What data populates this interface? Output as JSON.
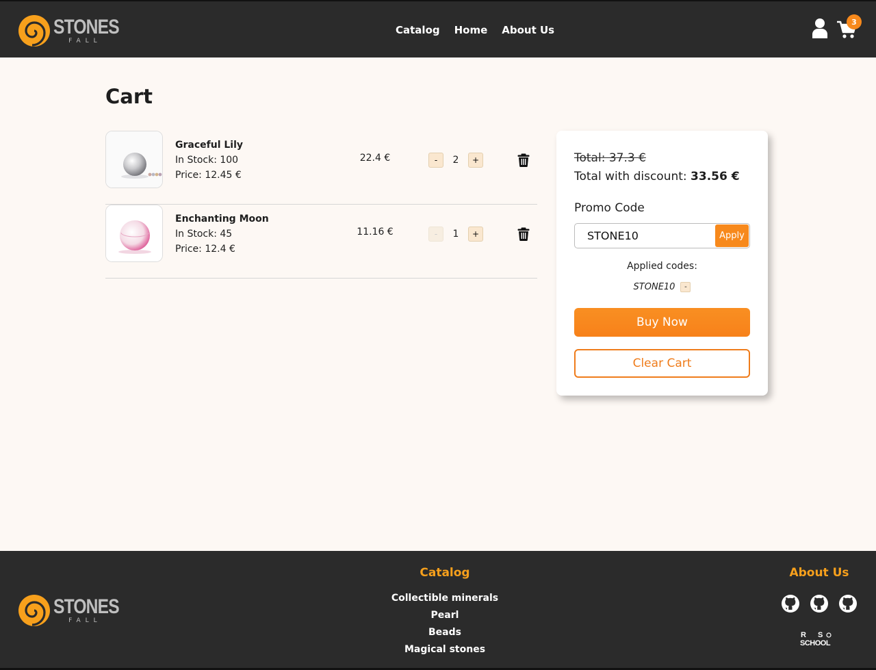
{
  "brand": {
    "name": "STONES",
    "sub": "FALL",
    "accent": "#f7891c"
  },
  "nav": {
    "items": [
      "Catalog",
      "Home",
      "About Us"
    ]
  },
  "header": {
    "cart_count": "3"
  },
  "page": {
    "title": "Cart"
  },
  "cart": {
    "items": [
      {
        "name": "Graceful Lily",
        "stock": "In Stock: 100",
        "price": "Price: 12.45 €",
        "total": "22.4 €",
        "qty": "2",
        "image": "pearl-white"
      },
      {
        "name": "Enchanting Moon",
        "stock": "In Stock: 45",
        "price": "Price: 12.4 €",
        "total": "11.16 €",
        "qty": "1",
        "image": "pearl-pink"
      }
    ],
    "minus": "-",
    "plus": "+"
  },
  "summary": {
    "total": "Total: 37.3 €",
    "discount_label": "Total with discount:",
    "discount_value": "33.56 €",
    "promo_label": "Promo Code",
    "promo_value": "STONE10",
    "apply": "Apply",
    "applied_label": "Applied codes:",
    "applied_codes": [
      "STONE10"
    ],
    "remove": "-",
    "buy": "Buy Now",
    "clear": "Clear Cart"
  },
  "footer": {
    "catalog_title": "Catalog",
    "catalog_links": [
      "Collectible minerals",
      "Pearl",
      "Beads",
      "Magical stones"
    ],
    "about_title": "About Us",
    "rs_school": "RS SCHOOL",
    "icons": [
      "github-icon",
      "github-icon",
      "github-icon"
    ]
  }
}
